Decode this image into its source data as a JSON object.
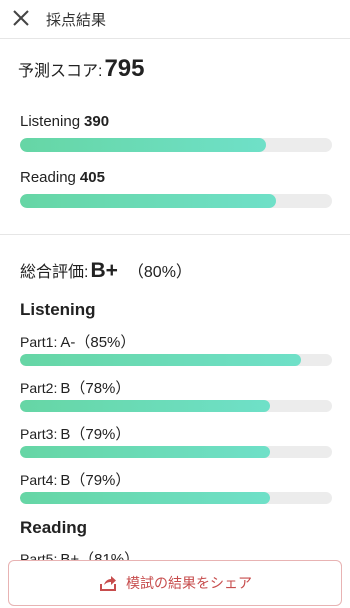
{
  "header": {
    "title": "採点結果"
  },
  "score": {
    "predicted_label": "予測スコア:",
    "predicted_value": "795",
    "sections": [
      {
        "label": "Listening",
        "value": "390",
        "fill": 0.79
      },
      {
        "label": "Reading",
        "value": "405",
        "fill": 0.82
      }
    ]
  },
  "overall": {
    "label": "総合評価:",
    "grade": "B+",
    "percent": "（80%）"
  },
  "listening": {
    "title": "Listening",
    "parts": [
      {
        "label": "Part1:",
        "grade": "A-（85%）",
        "fill": 0.9
      },
      {
        "label": "Part2:",
        "grade": "B（78%）",
        "fill": 0.8
      },
      {
        "label": "Part3:",
        "grade": "B（79%）",
        "fill": 0.8
      },
      {
        "label": "Part4:",
        "grade": "B（79%）",
        "fill": 0.8
      }
    ]
  },
  "reading": {
    "title": "Reading",
    "parts": [
      {
        "label": "Part5:",
        "grade": "B+（81%）"
      }
    ]
  },
  "share": {
    "label": "模試の結果をシェア"
  },
  "colors": {
    "bar_fill": "#66d6a5",
    "bar_track": "#ececec",
    "share_text": "#c74d4d",
    "share_border": "#e8b3b3"
  }
}
